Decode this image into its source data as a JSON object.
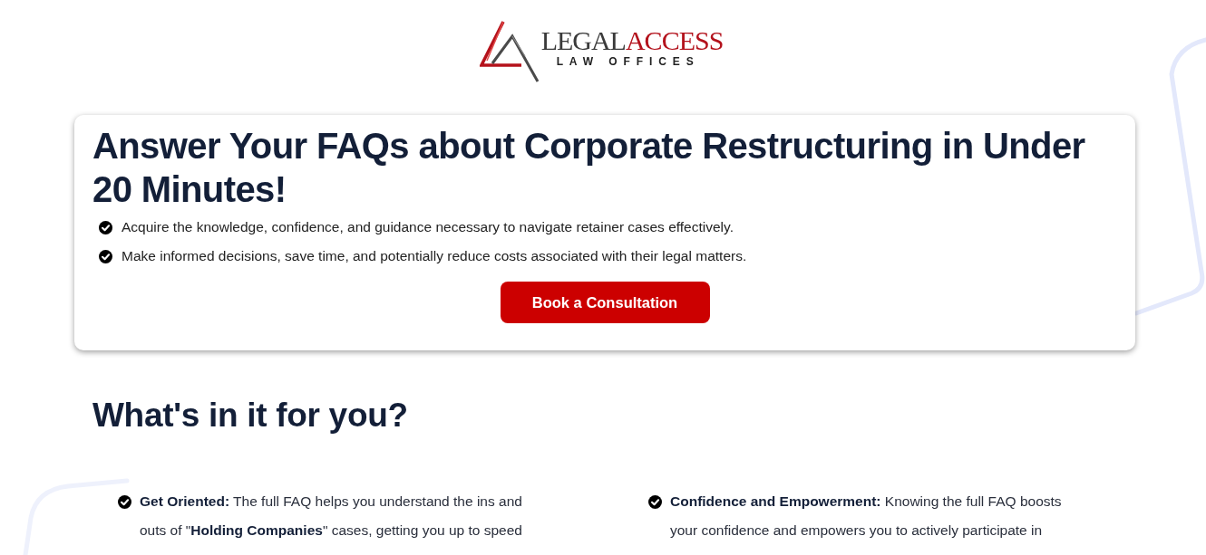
{
  "logo": {
    "wordmark": [
      {
        "text": "LEGAL",
        "kind": "plain"
      },
      {
        "text": "ACCESS",
        "kind": "accent"
      }
    ],
    "tagline": "LAW OFFICES"
  },
  "hero": {
    "title": "Answer Your FAQs about Corporate Restructuring in Under 20 Minutes!",
    "points": [
      "Acquire the knowledge, confidence, and guidance necessary to navigate retainer cases effectively.",
      "Make informed decisions, save time, and potentially reduce costs associated with their legal matters."
    ],
    "button": "Book a Consultation"
  },
  "benefits": {
    "heading": "What's in it for you?",
    "items": [
      "**Get Oriented:** The full FAQ helps you understand the ins and outs of \"**Holding Companies**\" cases, getting you up to speed",
      "**Confidence and Empowerment:** Knowing the full FAQ boosts your confidence and empowers you to actively participate in"
    ]
  }
}
